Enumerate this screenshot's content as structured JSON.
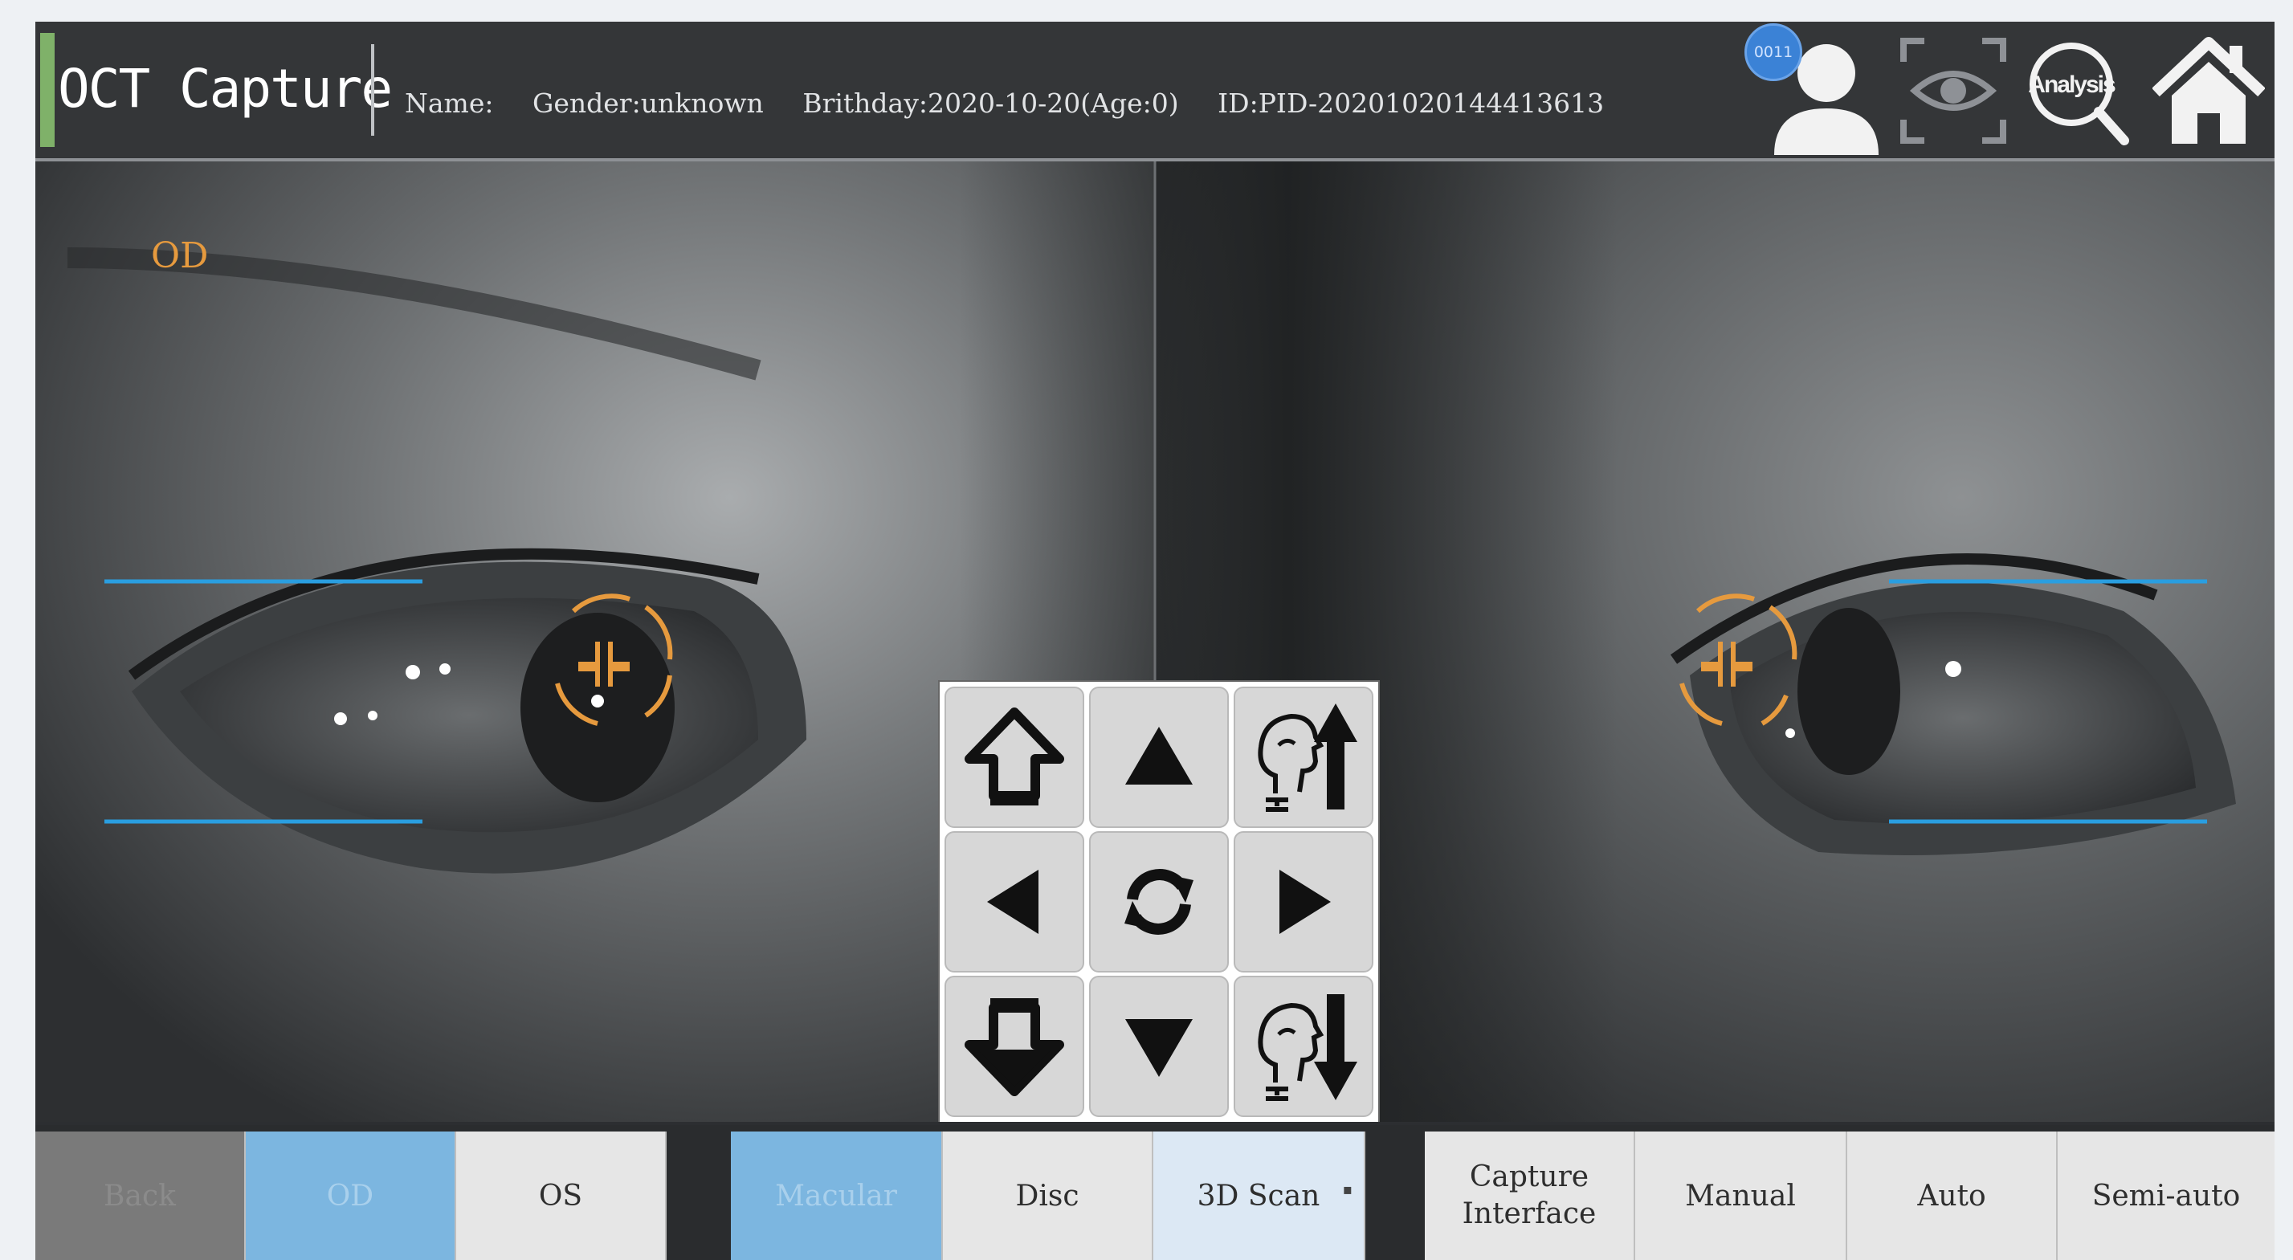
{
  "header": {
    "app_title": "OCT Capture",
    "patient": {
      "name": "Name:",
      "gender": "Gender:unknown",
      "birthday": "Brithday:2020-10-20(Age:0)",
      "id": "ID:PID-20201020144413613"
    },
    "badge_text": "0011",
    "analysis_text": "Analysis",
    "icons": [
      "user-icon",
      "eye-icon",
      "analysis-icon",
      "home-icon"
    ]
  },
  "camera": {
    "eye_label": "OD"
  },
  "pad": {
    "buttons": [
      "fast-up-arrow-icon",
      "up-triangle-icon",
      "head-up-icon",
      "left-triangle-icon",
      "refresh-icon",
      "right-triangle-icon",
      "fast-down-arrow-icon",
      "down-triangle-icon",
      "head-down-icon"
    ]
  },
  "toolbar": {
    "back": "Back",
    "od": "OD",
    "os": "OS",
    "macular": "Macular",
    "disc": "Disc",
    "scan_3d": "3D Scan",
    "capture_interface_line1": "Capture",
    "capture_interface_line2": "Interface",
    "manual": "Manual",
    "auto": "Auto",
    "semi_auto": "Semi-auto"
  },
  "colors": {
    "accent_green": "#7fb169",
    "selected_blue": "#7cb6e0",
    "target_orange": "#e69a3e",
    "guide_line_blue": "#2a9ee0",
    "badge_blue": "#3b82d6"
  }
}
